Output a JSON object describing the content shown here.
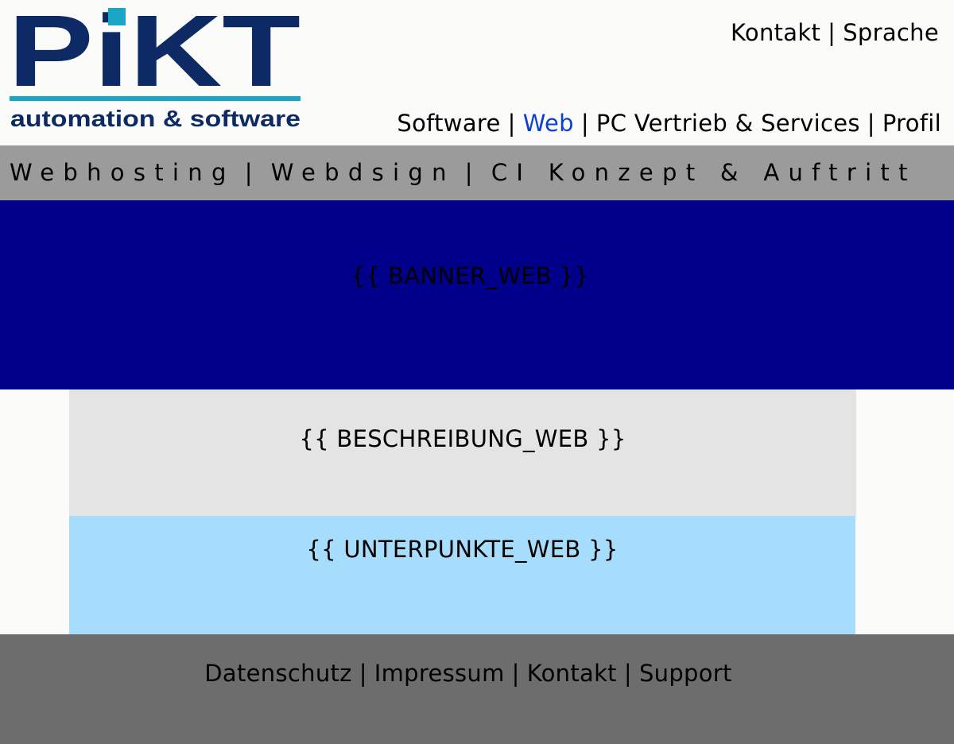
{
  "brand": {
    "logo_text": "PiKT",
    "tagline": "automation & software",
    "colors": {
      "navy": "#0d2a64",
      "accent": "#1aa6c4"
    }
  },
  "header": {
    "top_links": [
      {
        "label": "Kontakt"
      },
      {
        "label": "Sprache"
      }
    ],
    "separator": "|",
    "main_nav": [
      {
        "label": "Software",
        "active": false
      },
      {
        "label": "Web",
        "active": true
      },
      {
        "label": "PC Vertrieb & Services",
        "active": false
      },
      {
        "label": "Profil",
        "active": false
      }
    ]
  },
  "subnav": {
    "items": [
      {
        "label": "Webhosting"
      },
      {
        "label": "Webdsign"
      },
      {
        "label": "CI Konzept & Auftritt"
      }
    ]
  },
  "banner": {
    "placeholder": "{{ BANNER_WEB }}"
  },
  "description": {
    "placeholder": "{{ BESCHREIBUNG_WEB }}"
  },
  "subpoints": {
    "placeholder": "{{ UNTERPUNKTE_WEB }}"
  },
  "footer": {
    "links": [
      {
        "label": "Datenschutz"
      },
      {
        "label": "Impressum"
      },
      {
        "label": "Kontakt"
      },
      {
        "label": "Support"
      }
    ]
  },
  "colors": {
    "background": "#fbfcfa",
    "active_link": "#0d3fd8",
    "subnav_bg": "#9b9b9b",
    "banner_bg": "#00008b",
    "description_bg": "#e4e4e4",
    "subpoints_bg": "#a6ddfc",
    "footer_bg": "#6d6d6d"
  }
}
